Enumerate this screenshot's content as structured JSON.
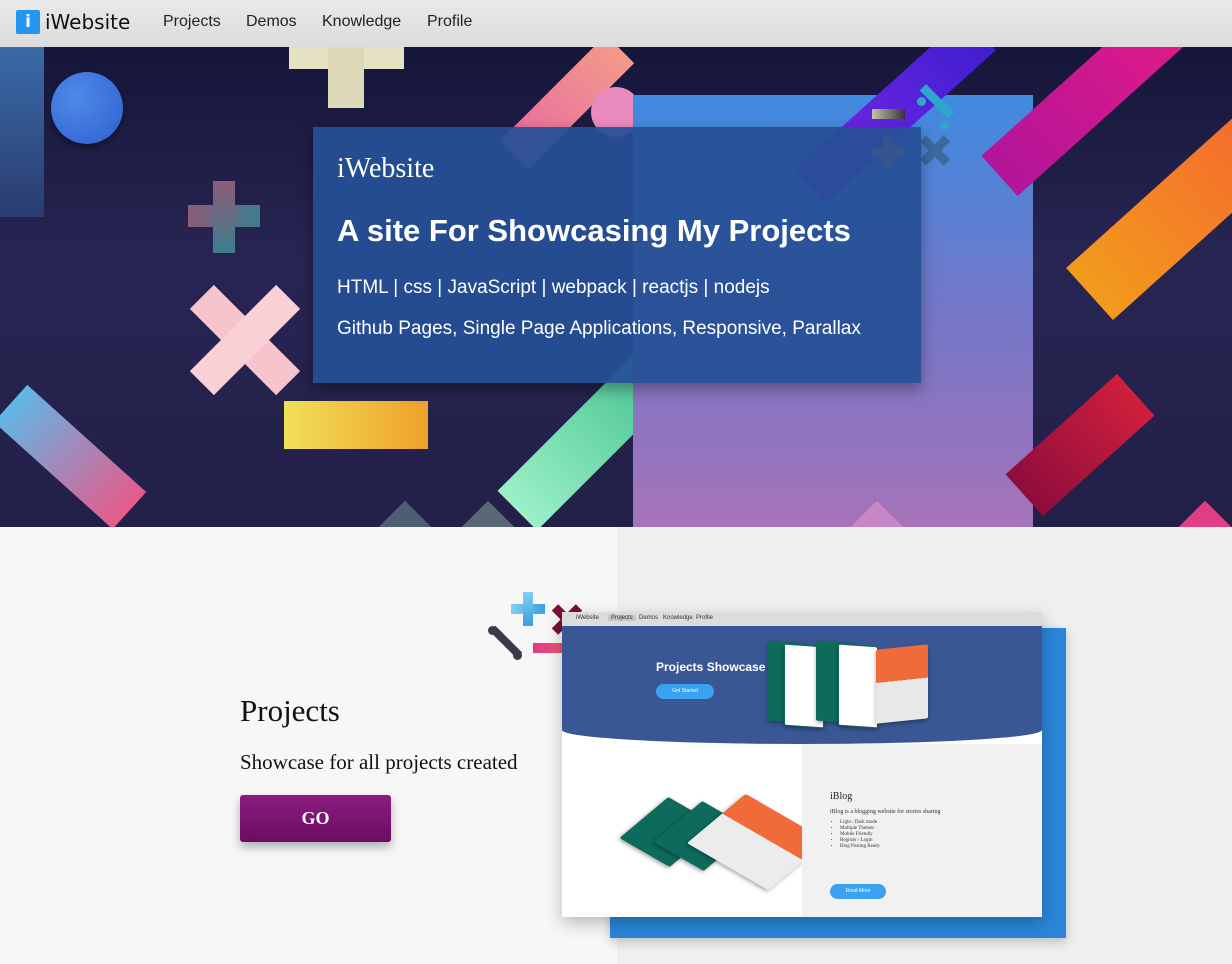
{
  "nav": {
    "logo_icon": "i",
    "brand": "iWebsite",
    "links": [
      "Projects",
      "Demos",
      "Knowledge",
      "Profile"
    ]
  },
  "hero": {
    "brand": "iWebsite",
    "title": "A site For Showcasing My Projects",
    "tech": "HTML | css | JavaScript | webpack | reactjs | nodejs",
    "features": "Github Pages, Single Page Applications, Responsive, Parallax"
  },
  "projects": {
    "title": "Projects",
    "description": "Showcase for all projects created",
    "button": "GO"
  },
  "preview": {
    "nav_brand": "iWebsite",
    "nav_links": [
      "Projects",
      "Demos",
      "Knowledge",
      "Profile"
    ],
    "hero_title": "Projects Showcase",
    "hero_button": "Get Started",
    "blog_title": "iBlog",
    "blog_description": "iBlog is a blogging website for stories sharing",
    "blog_features": [
      "Light / Dark mode",
      "Multiple Themes",
      "Mobile Friendly",
      "Register / Login",
      "Blog Posting Ready"
    ],
    "blog_button": "Read More"
  },
  "colors": {
    "accent": "#2196f3",
    "hero_card": "#26509a",
    "go_button": "#7a1570"
  }
}
